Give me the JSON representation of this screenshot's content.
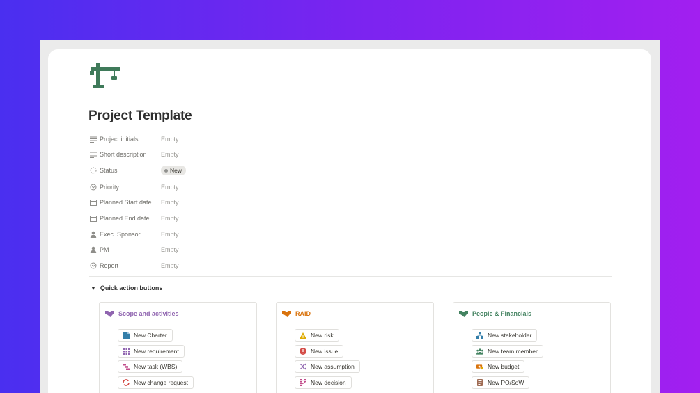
{
  "page": {
    "title": "Project Template",
    "icon": "crane-icon"
  },
  "properties": [
    {
      "name": "Project initials",
      "value": "Empty",
      "icon": "text-lines-icon"
    },
    {
      "name": "Short description",
      "value": "Empty",
      "icon": "text-lines-icon"
    },
    {
      "name": "Status",
      "value": "New",
      "icon": "status-spinner-icon",
      "type": "badge"
    },
    {
      "name": "Priority",
      "value": "Empty",
      "icon": "select-circle-icon"
    },
    {
      "name": "Planned Start date",
      "value": "Empty",
      "icon": "calendar-icon"
    },
    {
      "name": "Planned End date",
      "value": "Empty",
      "icon": "calendar-icon"
    },
    {
      "name": "Exec. Sponsor",
      "value": "Empty",
      "icon": "person-icon"
    },
    {
      "name": "PM",
      "value": "Empty",
      "icon": "person-icon"
    },
    {
      "name": "Report",
      "value": "Empty",
      "icon": "select-circle-icon"
    }
  ],
  "quick_actions": {
    "label": "Quick action buttons",
    "cards": [
      {
        "title": "Scope and activities",
        "title_color": "#9065b0",
        "icon": "handshake-icon",
        "buttons": [
          {
            "label": "New Charter",
            "icon": "document-icon"
          },
          {
            "label": "New requirement",
            "icon": "grid-icon"
          },
          {
            "label": "New task (WBS)",
            "icon": "hierarchy-icon"
          },
          {
            "label": "New change request",
            "icon": "change-icon"
          }
        ]
      },
      {
        "title": "RAID",
        "title_color": "#d9730d",
        "icon": "handshake-icon",
        "buttons": [
          {
            "label": "New risk",
            "icon": "warning-icon"
          },
          {
            "label": "New issue",
            "icon": "alert-icon"
          },
          {
            "label": "New assumption",
            "icon": "shuffle-icon"
          },
          {
            "label": "New decision",
            "icon": "branch-icon"
          }
        ]
      },
      {
        "title": "People & Financials",
        "title_color": "#448361",
        "icon": "handshake-icon",
        "buttons": [
          {
            "label": "New stakeholder",
            "icon": "org-icon"
          },
          {
            "label": "New team member",
            "icon": "team-icon"
          },
          {
            "label": "New budget",
            "icon": "money-icon"
          },
          {
            "label": "New PO/SoW",
            "icon": "receipt-icon"
          }
        ]
      }
    ]
  }
}
